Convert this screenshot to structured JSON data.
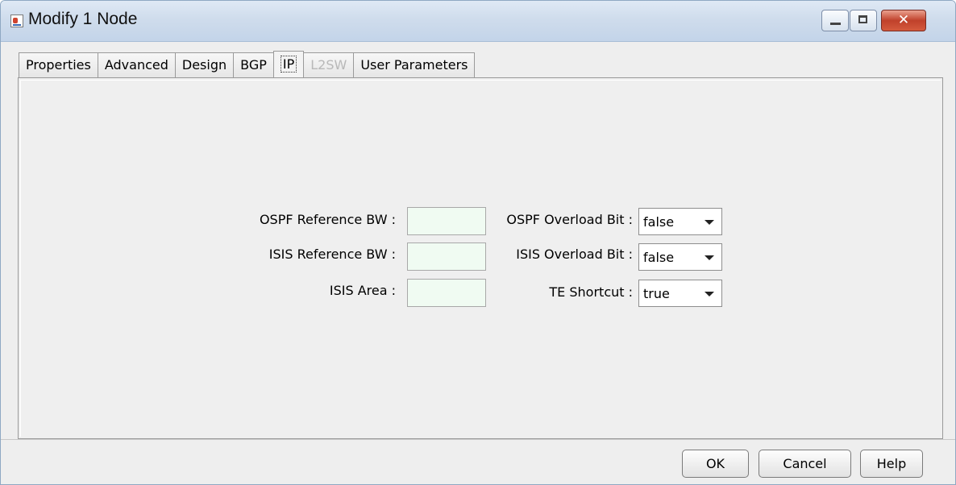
{
  "window": {
    "title": "Modify 1 Node",
    "close_glyph": "✕"
  },
  "tabs": [
    {
      "label": "Properties",
      "state": "normal"
    },
    {
      "label": "Advanced",
      "state": "normal"
    },
    {
      "label": "Design",
      "state": "normal"
    },
    {
      "label": "BGP",
      "state": "normal"
    },
    {
      "label": "IP",
      "state": "selected"
    },
    {
      "label": "L2SW",
      "state": "disabled"
    },
    {
      "label": "User Parameters",
      "state": "normal"
    }
  ],
  "form": {
    "ospf_ref_bw": {
      "label": "OSPF Reference BW :",
      "value": ""
    },
    "isis_ref_bw": {
      "label": "ISIS Reference BW :",
      "value": ""
    },
    "isis_area": {
      "label": "ISIS Area :",
      "value": ""
    },
    "ospf_overload": {
      "label": "OSPF Overload Bit :",
      "value": "false"
    },
    "isis_overload": {
      "label": "ISIS Overload Bit :",
      "value": "false"
    },
    "te_shortcut": {
      "label": "TE Shortcut :",
      "value": "true"
    }
  },
  "buttons": {
    "ok": "OK",
    "cancel": "Cancel",
    "help": "Help"
  },
  "colors": {
    "titlebar": "#c9d8ec",
    "field_bg": "#f0fbf2",
    "close_button": "#c0412b"
  }
}
